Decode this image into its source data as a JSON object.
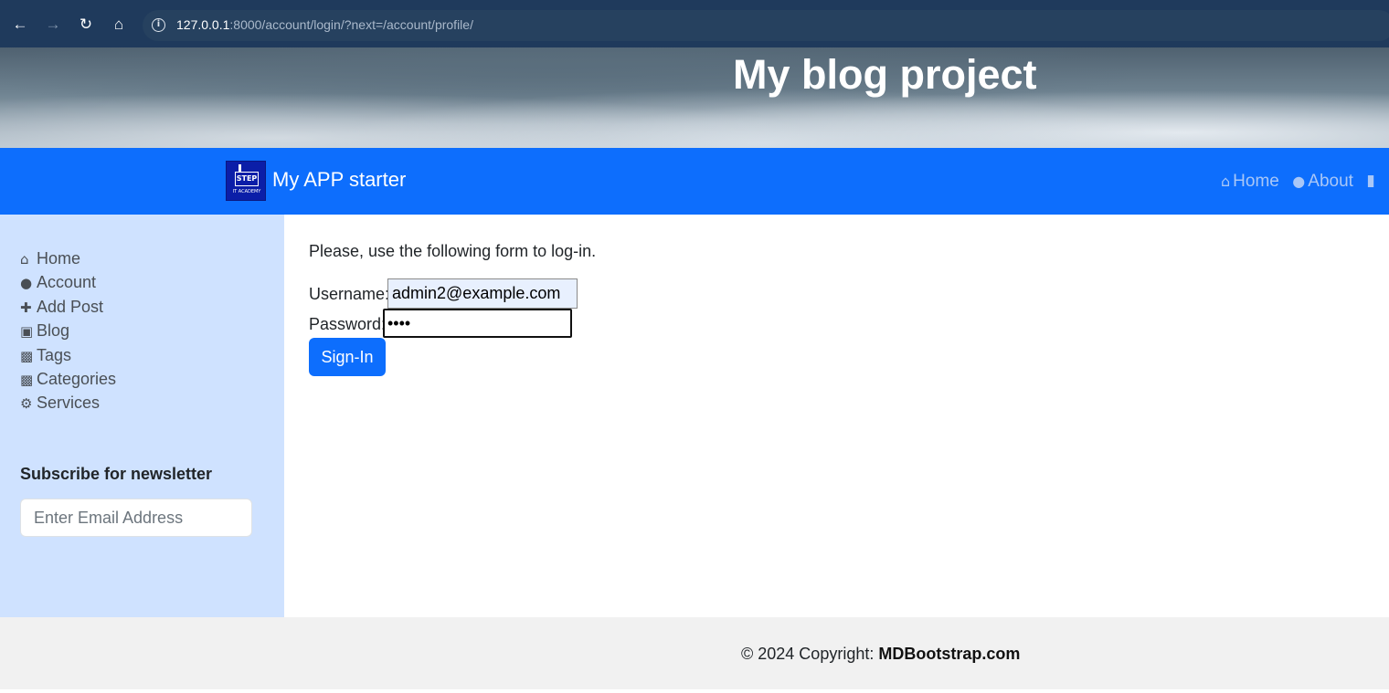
{
  "browser": {
    "back_icon": "arrow-left-icon",
    "forward_icon": "arrow-right-icon",
    "reload_icon": "reload-icon",
    "home_icon": "home-icon",
    "url_host": "127.0.0.1",
    "url_rest": ":8000/account/login/?next=/account/profile/"
  },
  "hero": {
    "title": "My blog project"
  },
  "navbar": {
    "brand": "My APP starter",
    "logo_text": "STEP",
    "logo_subtext": "IT ACADEMY",
    "items": [
      {
        "label": "Home",
        "icon": "home-icon"
      },
      {
        "label": "About",
        "icon": "user-icon"
      }
    ]
  },
  "sidebar": {
    "items": [
      {
        "label": "Home",
        "icon": "home-icon"
      },
      {
        "label": "Account",
        "icon": "user-icon"
      },
      {
        "label": "Add Post",
        "icon": "plus-icon"
      },
      {
        "label": "Blog",
        "icon": "note-icon"
      },
      {
        "label": "Tags",
        "icon": "briefcase-icon"
      },
      {
        "label": "Categories",
        "icon": "briefcase-icon"
      },
      {
        "label": "Services",
        "icon": "gears-icon"
      }
    ],
    "newsletter_title": "Subscribe for newsletter",
    "newsletter_placeholder": "Enter Email Address"
  },
  "login": {
    "intro": "Please, use the following form to log-in.",
    "username_label": "Username:",
    "username_value": "admin2@example.com",
    "password_label": "Password:",
    "password_value": "••••",
    "submit_label": "Sign-In"
  },
  "footer": {
    "prefix": "© 2024 Copyright: ",
    "brand": "MDBootstrap.com"
  },
  "colors": {
    "primary": "#0d6efd",
    "sidebar_bg": "#cfe2ff",
    "footer_bg": "#f1f1f1"
  }
}
